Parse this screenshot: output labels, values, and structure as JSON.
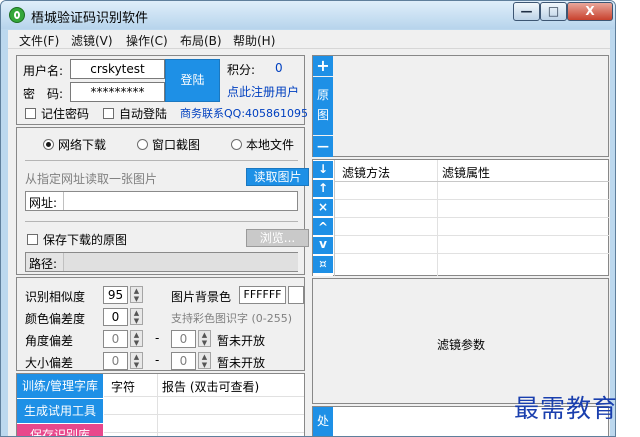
{
  "window": {
    "title": "梧城验证码识别软件",
    "controls": {
      "minimize": "—",
      "maximize": "□",
      "close": "X"
    }
  },
  "menu": [
    "文件(F)",
    "滤镜(V)",
    "操作(C)",
    "布局(B)",
    "帮助(H)"
  ],
  "login": {
    "username_label": "用户名:",
    "username_value": "crskytest",
    "password_label": "密　码:",
    "password_value": "*********",
    "login_button": "登陆",
    "points_label": "积分:",
    "points_value": "0",
    "register_link": "点此注册用户",
    "remember_label": "记住密码",
    "auto_login_label": "自动登陆",
    "contact": "商务联系QQ:405861095"
  },
  "source": {
    "options": [
      "网络下载",
      "窗口截图",
      "本地文件"
    ],
    "selected": "网络下载",
    "hint": "从指定网址读取一张图片",
    "read_button": "读取图片",
    "url_label": "网址:",
    "url_value": "",
    "save_label": "保存下载的原图",
    "browse_button": "浏览...",
    "path_label": "路径:",
    "path_value": ""
  },
  "recognition": {
    "similarity_label": "识别相似度",
    "similarity_value": "95",
    "bg_color_label": "图片背景色",
    "bg_color_value": "FFFFFF",
    "color_dev_label": "颜色偏差度",
    "color_dev_value": "0",
    "color_hint": "支持彩色图识字 (0-255)",
    "angle_label": "角度偏差",
    "angle_from": "0",
    "angle_to": "0",
    "angle_note": "暂未开放",
    "size_label": "大小偏差",
    "size_from": "0",
    "size_to": "0",
    "size_note": "暂未开放",
    "dash": "-"
  },
  "lib": {
    "tabs": [
      "训练/管理字库",
      "生成试用工具",
      "保存识别库"
    ],
    "col_char": "字符",
    "col_report": "报告 (双击可查看)"
  },
  "image_bar": {
    "plus": "+",
    "label": "原图",
    "minus": "—"
  },
  "filter_bar": [
    "↓",
    "↑",
    "×",
    "^",
    "v",
    "¤"
  ],
  "filter_table": {
    "col_method": "滤镜方法",
    "col_attr": "滤镜属性"
  },
  "filter_params": "滤镜参数",
  "process_bar_label": "处",
  "watermark": "最需教育"
}
